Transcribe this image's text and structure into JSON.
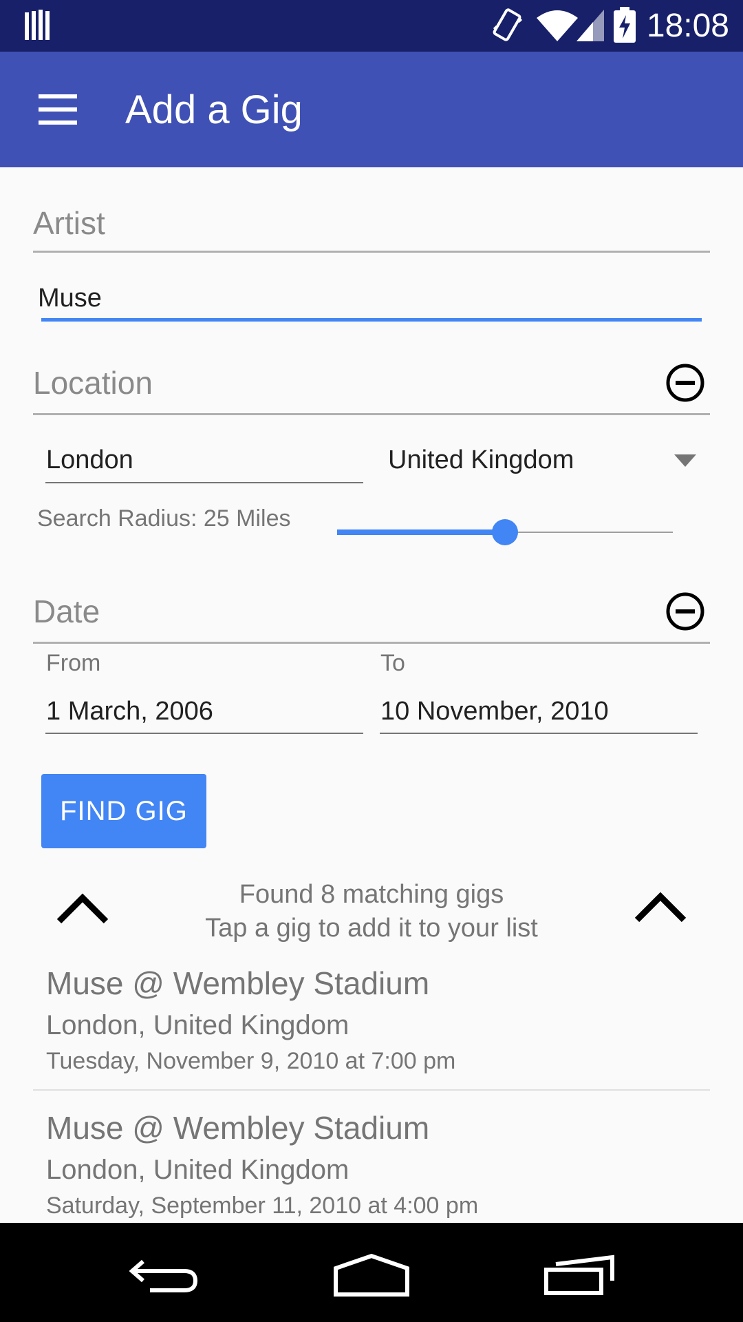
{
  "status_bar": {
    "time": "18:08"
  },
  "app_bar": {
    "title": "Add a Gig"
  },
  "artist": {
    "label": "Artist",
    "value": "Muse"
  },
  "location": {
    "label": "Location",
    "city": "London",
    "country": "United Kingdom",
    "radius_label": "Search Radius: 25 Miles",
    "radius_fraction": 0.5
  },
  "date": {
    "label": "Date",
    "from_label": "From",
    "to_label": "To",
    "from_value": "1 March, 2006",
    "to_value": "10 November, 2010"
  },
  "find_button": {
    "label": "FIND GIG"
  },
  "results": {
    "line1": "Found 8 matching gigs",
    "line2": "Tap a gig to add it to your list",
    "items": [
      {
        "title": "Muse @ Wembley Stadium",
        "location": "London, United Kingdom",
        "datetime": "Tuesday, November 9, 2010 at 7:00 pm"
      },
      {
        "title": "Muse @ Wembley Stadium",
        "location": "London, United Kingdom",
        "datetime": "Saturday, September 11, 2010 at 4:00 pm"
      }
    ]
  },
  "colors": {
    "accent": "#4285f4",
    "app_bar": "#3f51b5",
    "status_bar": "#172069"
  }
}
